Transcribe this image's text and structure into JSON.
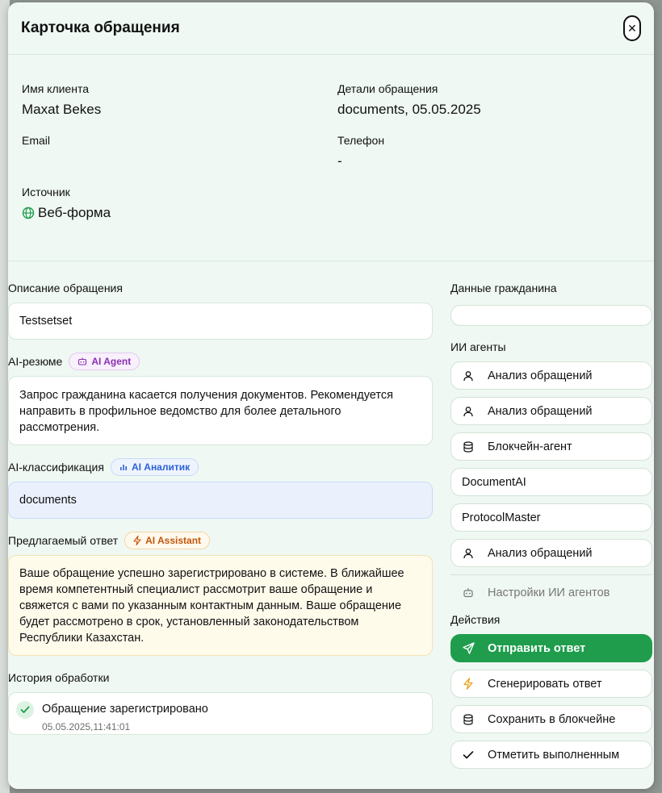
{
  "modal": {
    "title": "Карточка обращения",
    "close": "✕"
  },
  "info": {
    "client_name_label": "Имя клиента",
    "client_name": "Maxat Bekes",
    "details_label": "Детали обращения",
    "details": "documents, 05.05.2025",
    "email_label": "Email",
    "email": "",
    "phone_label": "Телефон",
    "phone": "-",
    "source_label": "Источник",
    "source": "Веб-форма",
    "source_icon": "globe-icon"
  },
  "description": {
    "label": "Описание обращения",
    "text": "Testsetset"
  },
  "ai_summary": {
    "label": "AI-резюме",
    "badge": "AI Agent",
    "text": "Запрос гражданина касается получения документов. Рекомендуется направить в профильное ведомство для более детального рассмотрения."
  },
  "ai_classification": {
    "label": "AI-классификация",
    "badge": "AI Аналитик",
    "text": "documents"
  },
  "suggested_answer": {
    "label": "Предлагаемый ответ",
    "badge": "AI Assistant",
    "text": "Ваше обращение успешно зарегистрировано в системе. В ближайшее время компетентный специалист рассмотрит ваше обращение и свяжется с вами по указанным контактным данным. Ваше обращение будет рассмотрено в срок, установленный законодательством Республики Казахстан."
  },
  "history": {
    "label": "История обработки",
    "items": [
      {
        "title": "Обращение зарегистрировано",
        "time": "05.05.2025,11:41:01"
      }
    ]
  },
  "citizen": {
    "label": "Данные гражданина",
    "value": ""
  },
  "agents": {
    "label": "ИИ агенты",
    "items": [
      {
        "label": "Анализ обращений",
        "icon": "user-icon"
      },
      {
        "label": "Анализ обращений",
        "icon": "user-icon"
      },
      {
        "label": "Блокчейн-агент",
        "icon": "database-icon"
      },
      {
        "label": "DocumentAI",
        "icon": ""
      },
      {
        "label": "ProtocolMaster",
        "icon": ""
      },
      {
        "label": "Анализ обращений",
        "icon": "user-icon"
      }
    ],
    "settings": "Настройки ИИ агентов"
  },
  "actions": {
    "label": "Действия",
    "send": "Отправить ответ",
    "generate": "Сгенерировать ответ",
    "save_blockchain": "Сохранить в блокчейне",
    "mark_done": "Отметить выполненным"
  },
  "colors": {
    "primary_green": "#1f9d4d",
    "modal_bg": "#eff8f2"
  }
}
